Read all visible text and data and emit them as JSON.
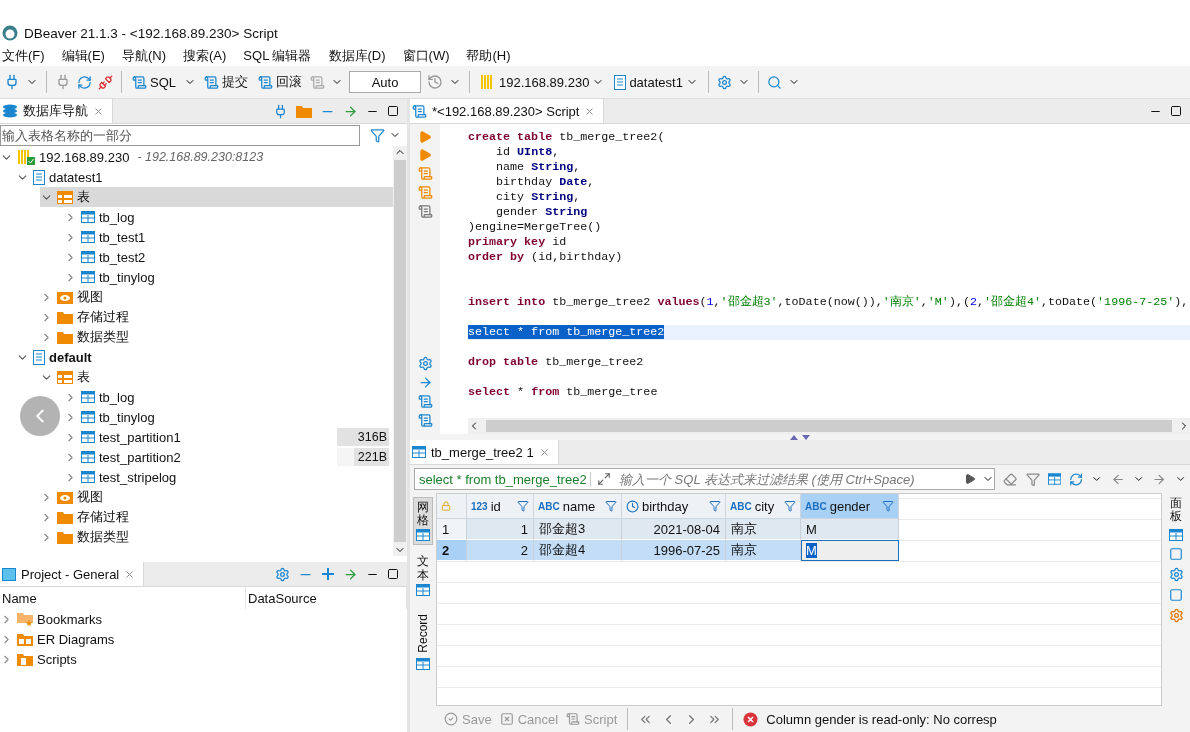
{
  "window": {
    "title": "DBeaver 21.1.3 - <192.168.89.230> Script"
  },
  "menu": [
    "文件(F)",
    "编辑(E)",
    "导航(N)",
    "搜索(A)",
    "SQL 编辑器",
    "数据库(D)",
    "窗口(W)",
    "帮助(H)"
  ],
  "toolbar": {
    "sql": "SQL",
    "commit": "提交",
    "rollback": "回滚",
    "transaction_mode": "Auto",
    "connection": "192.168.89.230",
    "database": "datatest1"
  },
  "navigator": {
    "title": "数据库导航",
    "filter": {
      "placeholder": "输入表格名称的一部分"
    },
    "tree": [
      {
        "label": "192.168.89.230",
        "detail": "- 192.168.89.230:8123",
        "kind": "server",
        "expanded": true,
        "selected": false,
        "children": [
          {
            "label": "datatest1",
            "kind": "database",
            "expanded": true,
            "selected": false,
            "bold": false,
            "children": [
              {
                "label": "表",
                "kind": "tables",
                "expanded": true,
                "selected": true,
                "children": [
                  {
                    "label": "tb_log",
                    "kind": "table",
                    "expanded": false,
                    "selected": false
                  },
                  {
                    "label": "tb_test1",
                    "kind": "table",
                    "expanded": false,
                    "selected": false
                  },
                  {
                    "label": "tb_test2",
                    "kind": "table",
                    "expanded": false,
                    "selected": false
                  },
                  {
                    "label": "tb_tinylog",
                    "kind": "table",
                    "expanded": false,
                    "selected": false
                  }
                ]
              },
              {
                "label": "视图",
                "kind": "views",
                "expanded": false,
                "selected": false
              },
              {
                "label": "存储过程",
                "kind": "folder",
                "expanded": false,
                "selected": false
              },
              {
                "label": "数据类型",
                "kind": "folder",
                "expanded": false,
                "selected": false
              }
            ]
          },
          {
            "label": "default",
            "kind": "database",
            "expanded": true,
            "selected": false,
            "bold": true,
            "children": [
              {
                "label": "表",
                "kind": "tables",
                "expanded": true,
                "selected": false,
                "children": [
                  {
                    "label": "tb_log",
                    "kind": "table",
                    "expanded": false,
                    "selected": false
                  },
                  {
                    "label": "tb_tinylog",
                    "kind": "table",
                    "expanded": false,
                    "selected": false
                  },
                  {
                    "label": "test_partition1",
                    "kind": "table",
                    "expanded": false,
                    "selected": false,
                    "size": "316B",
                    "level": 1
                  },
                  {
                    "label": "test_partition2",
                    "kind": "table",
                    "expanded": false,
                    "selected": false,
                    "size": "221B",
                    "level": 0.68
                  },
                  {
                    "label": "test_stripelog",
                    "kind": "table",
                    "expanded": false,
                    "selected": false
                  }
                ]
              },
              {
                "label": "视图",
                "kind": "views",
                "expanded": false,
                "selected": false
              },
              {
                "label": "存储过程",
                "kind": "folder",
                "expanded": false,
                "selected": false
              },
              {
                "label": "数据类型",
                "kind": "folder",
                "expanded": false,
                "selected": false
              }
            ]
          }
        ]
      }
    ]
  },
  "project": {
    "title": "Project - General",
    "columns": [
      "Name",
      "DataSource"
    ],
    "items": [
      {
        "label": "Bookmarks",
        "kind": "bookmarks",
        "expanded": false
      },
      {
        "label": "ER Diagrams",
        "kind": "diagrams",
        "expanded": false
      },
      {
        "label": "Scripts",
        "kind": "scripts",
        "expanded": false
      }
    ]
  },
  "editor": {
    "tab": "*<192.168.89.230> Script",
    "lines": [
      {
        "kind": "code",
        "tokens": [
          {
            "t": "create table",
            "kind": "keyword"
          },
          {
            "t": " tb_merge_tree2(",
            "kind": "plain"
          }
        ]
      },
      {
        "kind": "code",
        "tokens": [
          {
            "t": "    id ",
            "kind": "plain"
          },
          {
            "t": "UInt8",
            "kind": "type"
          },
          {
            "t": ",",
            "kind": "plain"
          }
        ]
      },
      {
        "kind": "code",
        "tokens": [
          {
            "t": "    name ",
            "kind": "plain"
          },
          {
            "t": "String",
            "kind": "type"
          },
          {
            "t": ",",
            "kind": "plain"
          }
        ]
      },
      {
        "kind": "code",
        "tokens": [
          {
            "t": "    birthday ",
            "kind": "plain"
          },
          {
            "t": "Date",
            "kind": "type"
          },
          {
            "t": ",",
            "kind": "plain"
          }
        ]
      },
      {
        "kind": "code",
        "tokens": [
          {
            "t": "    city ",
            "kind": "plain"
          },
          {
            "t": "String",
            "kind": "type"
          },
          {
            "t": ",",
            "kind": "plain"
          }
        ]
      },
      {
        "kind": "code",
        "tokens": [
          {
            "t": "    gender ",
            "kind": "plain"
          },
          {
            "t": "String",
            "kind": "type"
          }
        ]
      },
      {
        "kind": "code",
        "tokens": [
          {
            "t": ")engine=MergeTree()",
            "kind": "plain"
          }
        ]
      },
      {
        "kind": "code",
        "tokens": [
          {
            "t": "primary key",
            "kind": "keyword"
          },
          {
            "t": " id",
            "kind": "plain"
          }
        ]
      },
      {
        "kind": "code",
        "tokens": [
          {
            "t": "order by",
            "kind": "keyword"
          },
          {
            "t": " (id,birthday)",
            "kind": "plain"
          }
        ]
      },
      {
        "kind": "blank"
      },
      {
        "kind": "blank"
      },
      {
        "kind": "code",
        "tokens": [
          {
            "t": "insert into",
            "kind": "keyword"
          },
          {
            "t": " tb_merge_tree2 ",
            "kind": "plain"
          },
          {
            "t": "values",
            "kind": "keyword"
          },
          {
            "t": "(",
            "kind": "plain"
          },
          {
            "t": "1",
            "kind": "number"
          },
          {
            "t": ",",
            "kind": "plain"
          },
          {
            "t": "'邵金超3'",
            "kind": "string"
          },
          {
            "t": ",toDate(now()),",
            "kind": "plain"
          },
          {
            "t": "'南京'",
            "kind": "string"
          },
          {
            "t": ",",
            "kind": "plain"
          },
          {
            "t": "'M'",
            "kind": "string"
          },
          {
            "t": "),(",
            "kind": "plain"
          },
          {
            "t": "2",
            "kind": "number"
          },
          {
            "t": ",",
            "kind": "plain"
          },
          {
            "t": "'邵金超4'",
            "kind": "string"
          },
          {
            "t": ",toDate(",
            "kind": "plain"
          },
          {
            "t": "'1996-7-25'",
            "kind": "string"
          },
          {
            "t": "),",
            "kind": "plain"
          }
        ]
      },
      {
        "kind": "blank"
      },
      {
        "kind": "code",
        "selected": true,
        "tokens": [
          {
            "t": "select * from tb_merge_tree2",
            "kind": "plain"
          }
        ]
      },
      {
        "kind": "blank"
      },
      {
        "kind": "code",
        "tokens": [
          {
            "t": "drop table",
            "kind": "keyword"
          },
          {
            "t": " tb_merge_tree2",
            "kind": "plain"
          }
        ]
      },
      {
        "kind": "blank"
      },
      {
        "kind": "code",
        "tokens": [
          {
            "t": "select",
            "kind": "keyword"
          },
          {
            "t": " * ",
            "kind": "plain"
          },
          {
            "t": "from",
            "kind": "keyword"
          },
          {
            "t": " tb_merge_tree",
            "kind": "plain"
          }
        ]
      }
    ]
  },
  "results": {
    "tab": "tb_merge_tree2 1",
    "query": "select * from tb_merge_tree2",
    "filter": {
      "placeholder": "输入一个 SQL 表达式来过滤结果 (使用 Ctrl+Space)"
    },
    "side_tabs": [
      {
        "label": "网格",
        "kind": "vertical",
        "selected": true
      },
      {
        "label": "文本",
        "kind": "vertical",
        "selected": false
      },
      {
        "label": "Record",
        "kind": "rotated",
        "selected": false
      }
    ],
    "panel_label": "面板",
    "columns": [
      {
        "name": "id",
        "kind": "number",
        "type_label": "123",
        "selected": false
      },
      {
        "name": "name",
        "kind": "text",
        "type_label": "ABC",
        "selected": false
      },
      {
        "name": "birthday",
        "kind": "date",
        "selected": false
      },
      {
        "name": "city",
        "kind": "text",
        "type_label": "ABC",
        "selected": false
      },
      {
        "name": "gender",
        "kind": "text",
        "type_label": "ABC",
        "selected": true
      }
    ],
    "rows": [
      {
        "number": "1",
        "selected": false,
        "cells": [
          "1",
          "邵金超3",
          "2021-08-04",
          "南京",
          "M"
        ]
      },
      {
        "number": "2",
        "selected": true,
        "cells": [
          "2",
          "邵金超4",
          "1996-07-25",
          "南京",
          "M"
        ]
      }
    ],
    "actions": [
      {
        "label": "Save",
        "disabled": true
      },
      {
        "label": "Cancel",
        "disabled": true
      },
      {
        "label": "Script",
        "disabled": true
      }
    ],
    "status": "Column gender is read-only: No corresp"
  }
}
